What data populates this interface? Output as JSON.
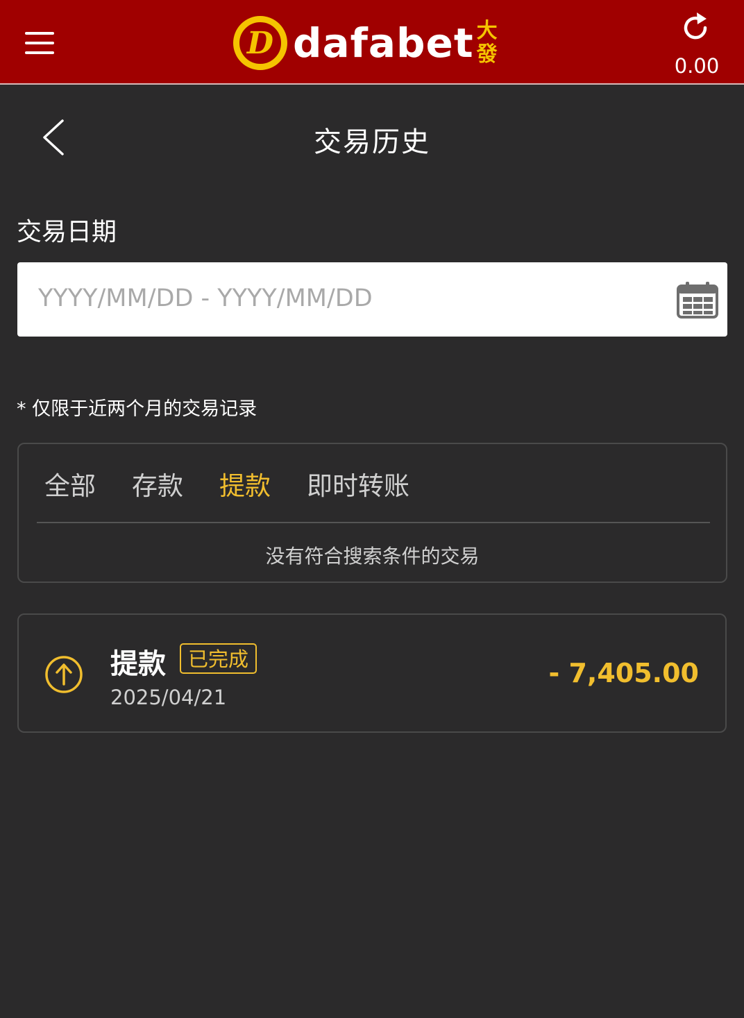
{
  "header": {
    "brand_text": "dafabet",
    "brand_cn_top": "大",
    "brand_cn_bottom": "發",
    "balance": "0.00",
    "menu_icon": "hamburger-menu-icon",
    "refresh_icon": "refresh-icon"
  },
  "page": {
    "title": "交易历史",
    "back_icon": "chevron-left-icon"
  },
  "filter": {
    "date_label": "交易日期",
    "date_placeholder": "YYYY/MM/DD - YYYY/MM/DD",
    "calendar_icon": "calendar-icon",
    "note": "* 仅限于近两个月的交易记录"
  },
  "tabs": {
    "items": [
      {
        "label": "全部",
        "active": false
      },
      {
        "label": "存款",
        "active": false
      },
      {
        "label": "提款",
        "active": true
      },
      {
        "label": "即时转账",
        "active": false
      }
    ],
    "empty_message": "没有符合搜索条件的交易"
  },
  "transactions": [
    {
      "type": "提款",
      "status": "已完成",
      "date": "2025/04/21",
      "amount": "- 7,405.00",
      "icon": "arrow-up-circle-icon"
    }
  ],
  "colors": {
    "header_red": "#a00000",
    "background": "#2b2a2b",
    "accent_gold": "#f1be2e",
    "logo_yellow": "#f5c400"
  }
}
